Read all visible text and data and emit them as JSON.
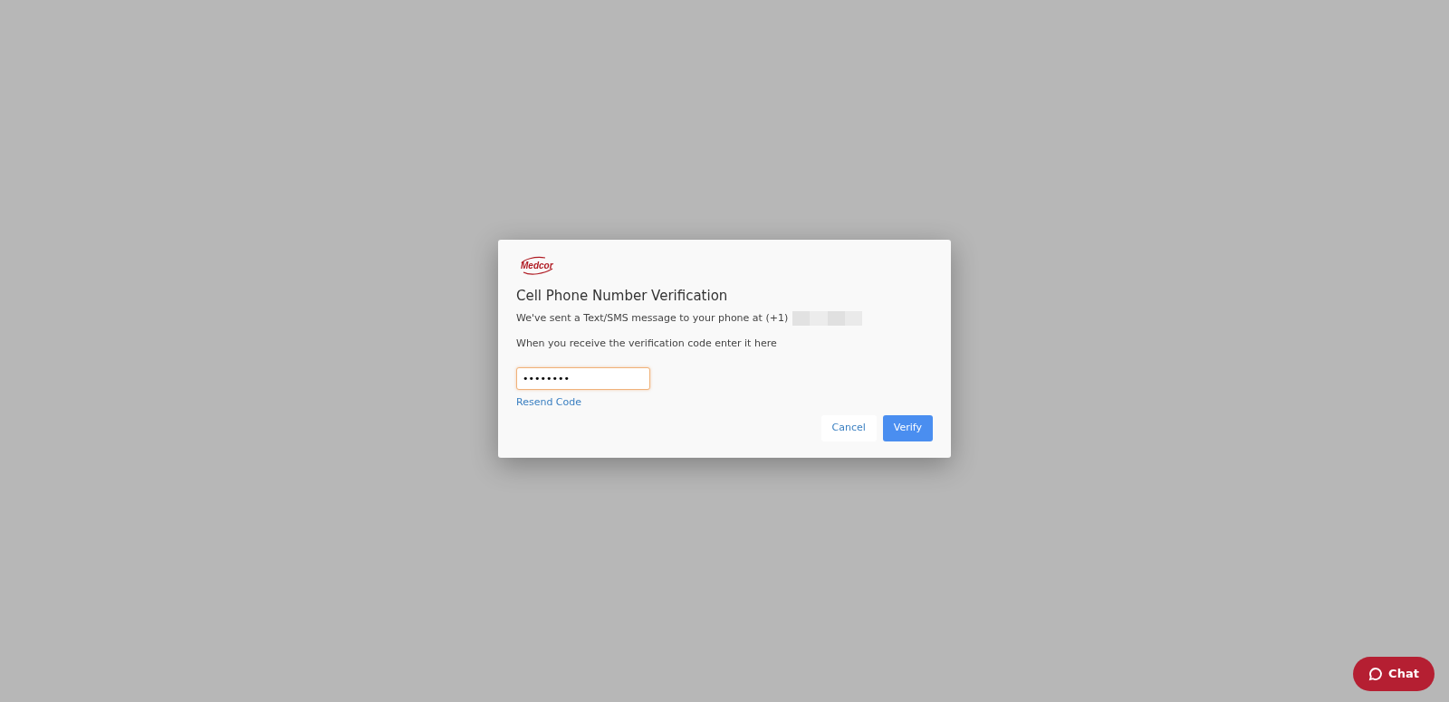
{
  "dialog": {
    "logo": "Medcor",
    "title": "Cell Phone Number Verification",
    "message": "We've sent a Text/SMS message to your phone at (+1)",
    "instruction": "When you receive the verification code enter it here",
    "code_field": {
      "value": "••••••••",
      "focused": true
    },
    "resend_link": "Resend Code",
    "buttons": [
      {
        "label": "Cancel",
        "kind": "secondary"
      },
      {
        "label": "Verify",
        "kind": "primary"
      }
    ]
  },
  "chat_button": {
    "label": "Chat"
  }
}
